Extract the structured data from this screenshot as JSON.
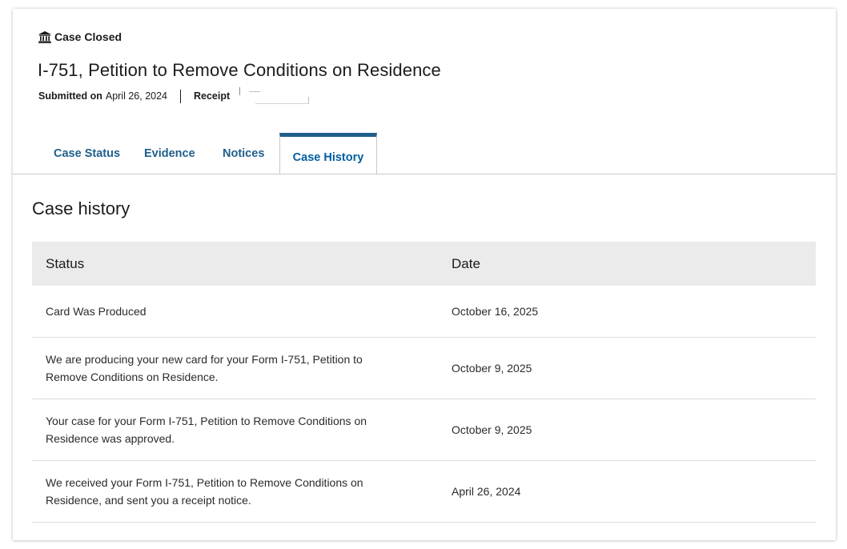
{
  "case": {
    "status_label": "Case Closed",
    "title": "I-751, Petition to Remove Conditions on Residence",
    "submitted_label": "Submitted on",
    "submitted_date": "April 26, 2024",
    "receipt_label": "Receipt"
  },
  "tabs": [
    {
      "label": "Case Status",
      "active": false
    },
    {
      "label": "Evidence",
      "active": false
    },
    {
      "label": "Notices",
      "active": false
    },
    {
      "label": "Case History",
      "active": true
    }
  ],
  "history": {
    "title": "Case history",
    "columns": [
      "Status",
      "Date"
    ],
    "rows": [
      {
        "status": "Card Was Produced",
        "date": "October 16, 2025"
      },
      {
        "status": "We are producing your new card for your Form I-751, Petition to Remove Conditions on Residence.",
        "date": "October 9, 2025"
      },
      {
        "status": "Your case for your Form I-751, Petition to Remove Conditions on Residence was approved.",
        "date": "October 9, 2025"
      },
      {
        "status": "We received your Form I-751, Petition to Remove Conditions on Residence, and sent you a receipt notice.",
        "date": "April 26, 2024"
      }
    ]
  },
  "icons": {
    "status_icon": "bank-building-icon"
  },
  "colors": {
    "tab_text": "#1f5f8b",
    "active_tab_accent": "#1f5f8b",
    "table_header_bg": "#ebebeb"
  }
}
